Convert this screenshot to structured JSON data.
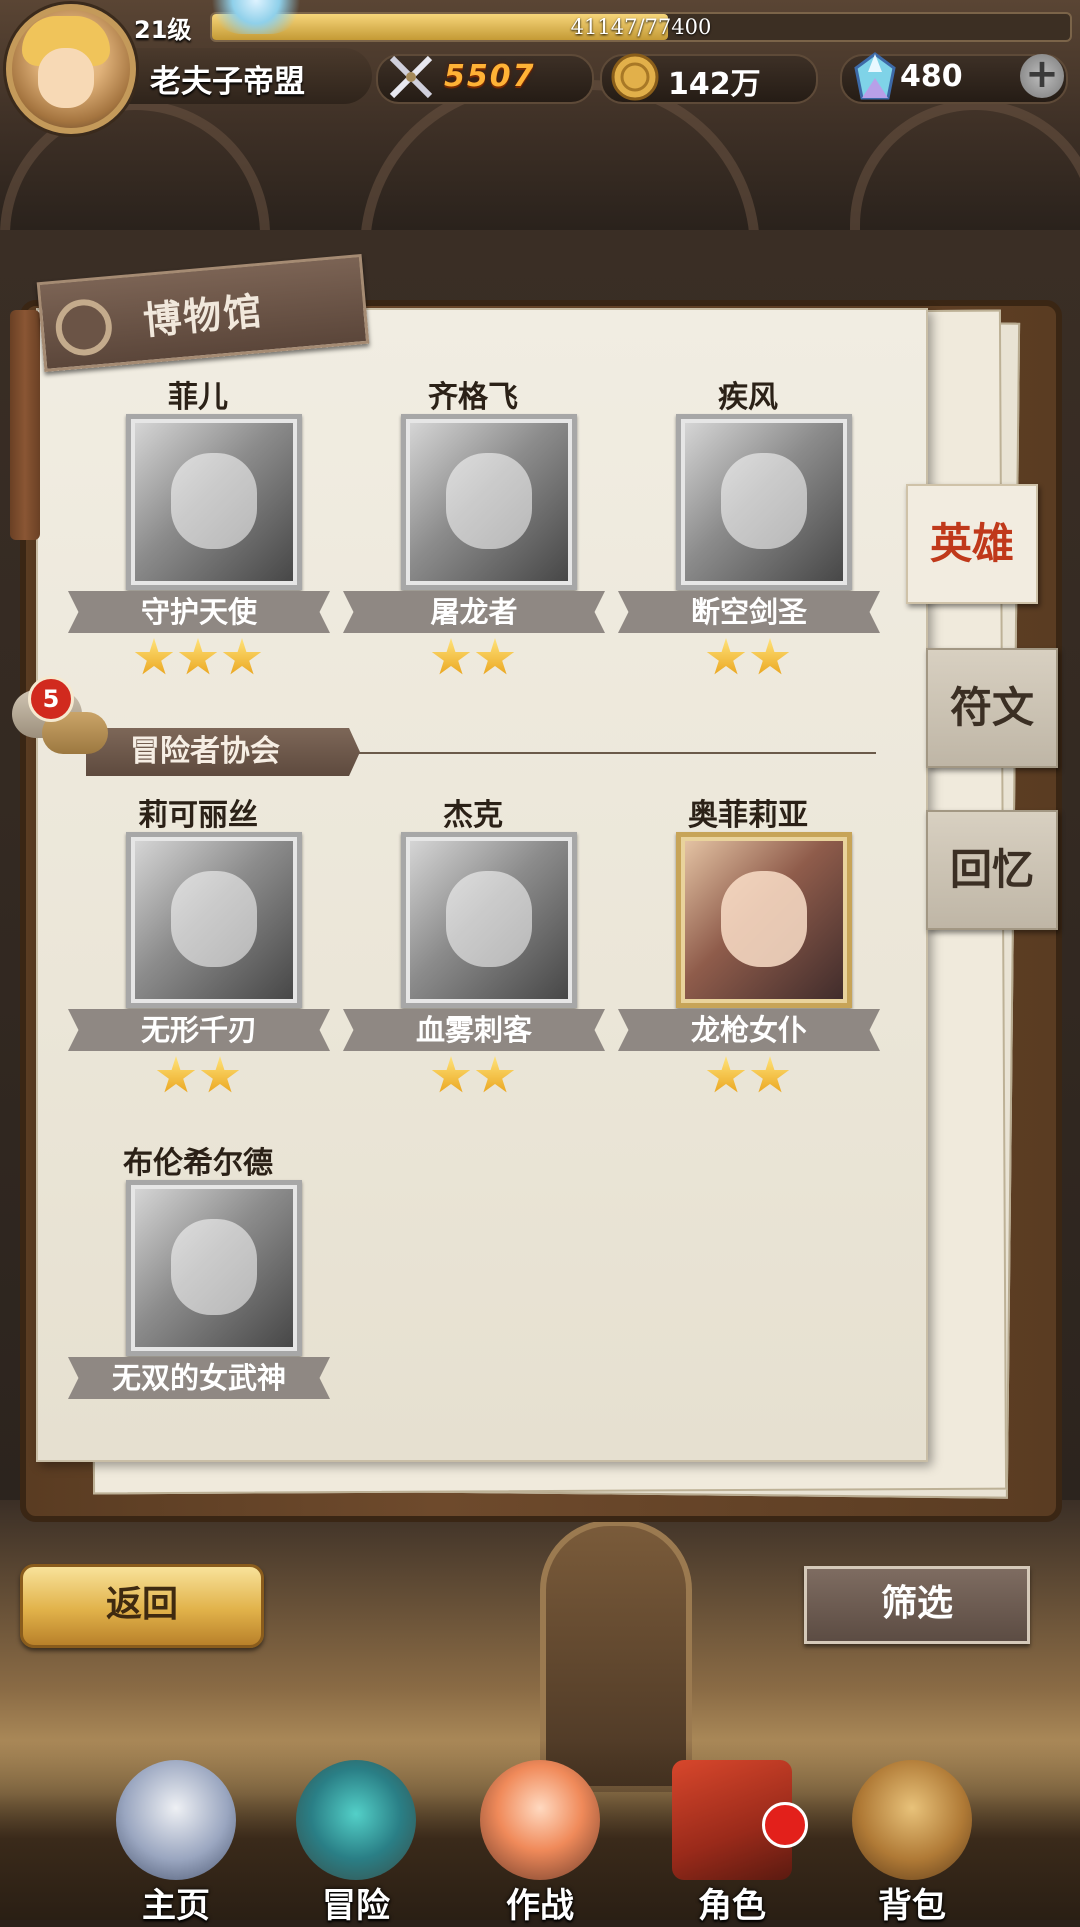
{
  "player": {
    "level": "21级",
    "xp_text": "41147/77400",
    "xp_progress": 0.5316,
    "name": "老夫子帝盟",
    "power": "5507",
    "gold": "142万",
    "gems": "480",
    "plus_label": "+"
  },
  "museum": {
    "title": "博物馆",
    "section_title": "冒险者协会",
    "section_badge": "5"
  },
  "heroes_top": [
    {
      "name": "菲儿",
      "title": "守护天使",
      "stars": 3,
      "owned": false
    },
    {
      "name": "齐格飞",
      "title": "屠龙者",
      "stars": 2,
      "owned": false
    },
    {
      "name": "疾风",
      "title": "断空剑圣",
      "stars": 2,
      "owned": false
    }
  ],
  "heroes_guild": [
    {
      "name": "莉可丽丝",
      "title": "无形千刃",
      "stars": 2,
      "owned": false
    },
    {
      "name": "杰克",
      "title": "血雾刺客",
      "stars": 2,
      "owned": false
    },
    {
      "name": "奥菲莉亚",
      "title": "龙枪女仆",
      "stars": 2,
      "owned": true
    },
    {
      "name": "布伦希尔德",
      "title": "无双的女武神",
      "stars": 0,
      "owned": false
    }
  ],
  "tabs": [
    {
      "label": "英雄",
      "active": true
    },
    {
      "label": "符文",
      "active": false
    },
    {
      "label": "回忆",
      "active": false
    }
  ],
  "buttons": {
    "back": "返回",
    "filter": "筛选"
  },
  "bottom_nav": [
    {
      "label": "主页",
      "icon": "home-castle-icon"
    },
    {
      "label": "冒险",
      "icon": "adventure-portal-icon"
    },
    {
      "label": "作战",
      "icon": "battle-character-icon"
    },
    {
      "label": "角色",
      "icon": "character-book-icon"
    },
    {
      "label": "背包",
      "icon": "backpack-icon"
    }
  ],
  "colors": {
    "active_tab_text": "#c0391b",
    "star": "#f2c230",
    "badge": "#d12a1e"
  }
}
